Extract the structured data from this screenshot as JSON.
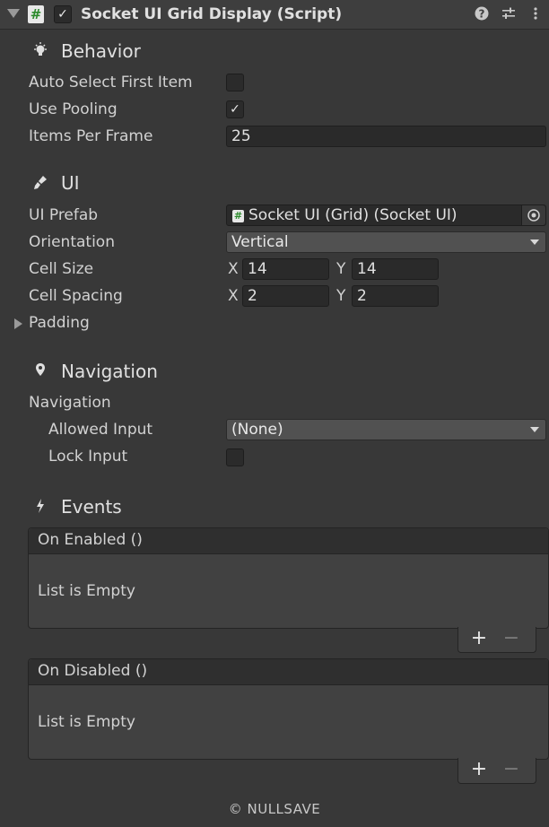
{
  "component": {
    "title": "Socket UI Grid Display (Script)",
    "enabled": true,
    "script_glyph": "#"
  },
  "behavior": {
    "title": "Behavior",
    "auto_select_label": "Auto Select First Item",
    "auto_select_value": false,
    "use_pooling_label": "Use Pooling",
    "use_pooling_value": true,
    "items_per_frame_label": "Items Per Frame",
    "items_per_frame_value": "25"
  },
  "ui": {
    "title": "UI",
    "prefab_label": "UI Prefab",
    "prefab_value": "Socket UI (Grid) (Socket UI)",
    "orientation_label": "Orientation",
    "orientation_value": "Vertical",
    "cell_size_label": "Cell Size",
    "cell_size_x": "14",
    "cell_size_y": "14",
    "cell_spacing_label": "Cell Spacing",
    "cell_spacing_x": "2",
    "cell_spacing_y": "2",
    "x_label": "X",
    "y_label": "Y",
    "padding_label": "Padding"
  },
  "navigation": {
    "title": "Navigation",
    "group_label": "Navigation",
    "allowed_input_label": "Allowed Input",
    "allowed_input_value": "(None)",
    "lock_input_label": "Lock Input",
    "lock_input_value": false
  },
  "events": {
    "title": "Events",
    "on_enabled_label": "On Enabled ()",
    "on_enabled_empty": "List is Empty",
    "on_disabled_label": "On Disabled ()",
    "on_disabled_empty": "List is Empty",
    "plus": "+",
    "minus": "−"
  },
  "footer": "© NULLSAVE",
  "icons": {
    "help": "help-icon",
    "preset": "preset-sliders-icon",
    "menu": "kebab-menu-icon",
    "behavior": "lightbulb-icon",
    "ui": "brush-icon",
    "navigation": "map-pin-icon",
    "events": "lightning-icon"
  }
}
